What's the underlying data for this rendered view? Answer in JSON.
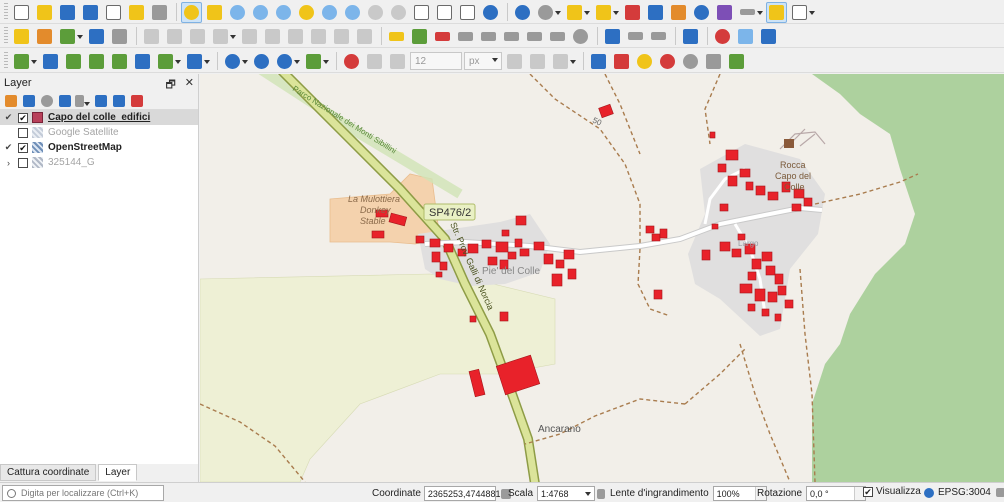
{
  "toolbars": {
    "row1": [
      "new-project",
      "open-project",
      "save-project",
      "save-as",
      "new-print-layout",
      "layout-manager",
      "style-manager",
      "pan-map",
      "pan-to-selection",
      "zoom-in",
      "zoom-out",
      "zoom-full",
      "zoom-to-selection",
      "zoom-to-layer",
      "zoom-native",
      "zoom-last",
      "zoom-next",
      "new-map-view",
      "new-bookmark",
      "show-bookmarks",
      "refresh",
      "identify",
      "actions",
      "select-features",
      "deselect",
      "open-attribute-table",
      "field-calculator",
      "statistical-summary",
      "toolbox",
      "measure-line",
      "map-tips",
      "text-annotation"
    ],
    "row2": [
      "digitize-current-layer",
      "toggle-editing",
      "save-edits",
      "add-feature",
      "vertex-tool",
      "delete-selected",
      "cut-features",
      "copy-features",
      "paste-features",
      "undo",
      "redo",
      "label-toolbar",
      "layer-labeling",
      "pin-labels",
      "show-hide-labels",
      "preview-labels",
      "move-label",
      "rotate-label",
      "change-label",
      "label-settings",
      "python-console",
      "kml-export",
      "html-export",
      "help",
      "coordinate-capture",
      "plugin-tool"
    ],
    "row3": [
      "add-vector-layer",
      "add-raster-layer",
      "add-delimited-text",
      "add-spatialite",
      "add-virtual-layer",
      "add-wms",
      "add-wcs",
      "add-wfs",
      "add-vector-tile",
      "add-xyz",
      "new-shapefile",
      "new-geopackage",
      "snapping",
      "enable-tracing",
      "advanced-digitize",
      "split-features",
      "merge-features",
      "offset-curve",
      "reshape",
      "plugin-a",
      "plugin-b",
      "plugin-c",
      "plugin-d",
      "plugin-e",
      "plugin-f",
      "plugin-g"
    ],
    "font_size_value": "12",
    "font_unit_value": "px"
  },
  "layer_panel": {
    "title": "Layer",
    "float_glyph": "🗗",
    "close_glyph": "✕",
    "layers": [
      {
        "name": "Capo del colle_edifici",
        "checked": true,
        "expanded": true,
        "selected": true,
        "bold": true,
        "underline": true,
        "color": "#b8405a",
        "dim": false
      },
      {
        "name": "Google Satellite",
        "checked": false,
        "expanded": false,
        "selected": false,
        "bold": false,
        "underline": false,
        "color": "#9aa7b8",
        "dim": true
      },
      {
        "name": "OpenStreetMap",
        "checked": true,
        "expanded": true,
        "selected": false,
        "bold": true,
        "underline": false,
        "color": "#6f8fb8",
        "dim": false
      },
      {
        "name": "325144_G",
        "checked": false,
        "expanded": false,
        "selected": false,
        "bold": false,
        "underline": false,
        "color": "#b0b8c6",
        "dim": true
      }
    ],
    "tabs": [
      {
        "label": "Cattura coordinate",
        "active": false
      },
      {
        "label": "Layer",
        "active": true
      }
    ]
  },
  "map": {
    "labels": {
      "road_shield": "SP476/2",
      "park": "Parco Nazionale dei Monti Sibillini",
      "stable_line1": "La Mulottiera",
      "stable_line2": "Donkey",
      "stable_line3": "Stable",
      "village_west": "Pie' del Colle",
      "road_name": "Str. Prov. Galli di Norcia",
      "castle_line1": "Rocca",
      "castle_line2": "Capo del",
      "castle_line3": "Colle",
      "hamlet": "Ancarano",
      "road_number": "50",
      "square": "Largo"
    },
    "colors": {
      "land": "#f2efe9",
      "forest": "#add19e",
      "meadow": "#eef0d5",
      "residential": "#e0dfdf",
      "buildings": "#e8222a",
      "main_road": "#9aa84a",
      "track": "#a97c4e"
    }
  },
  "statusbar": {
    "locator_placeholder": "Digita per localizzare (Ctrl+K)",
    "coordinate_label": "Coordinate",
    "coordinate_value": "2365253,4744881",
    "scale_label": "Scala",
    "scale_value": "1:4768",
    "magnifier_label": "Lente d'ingrandimento",
    "magnifier_value": "100%",
    "rotation_label": "Rotazione",
    "rotation_value": "0,0 °",
    "render_label": "Visualizza",
    "render_checked": true,
    "crs": "EPSG:3004"
  }
}
